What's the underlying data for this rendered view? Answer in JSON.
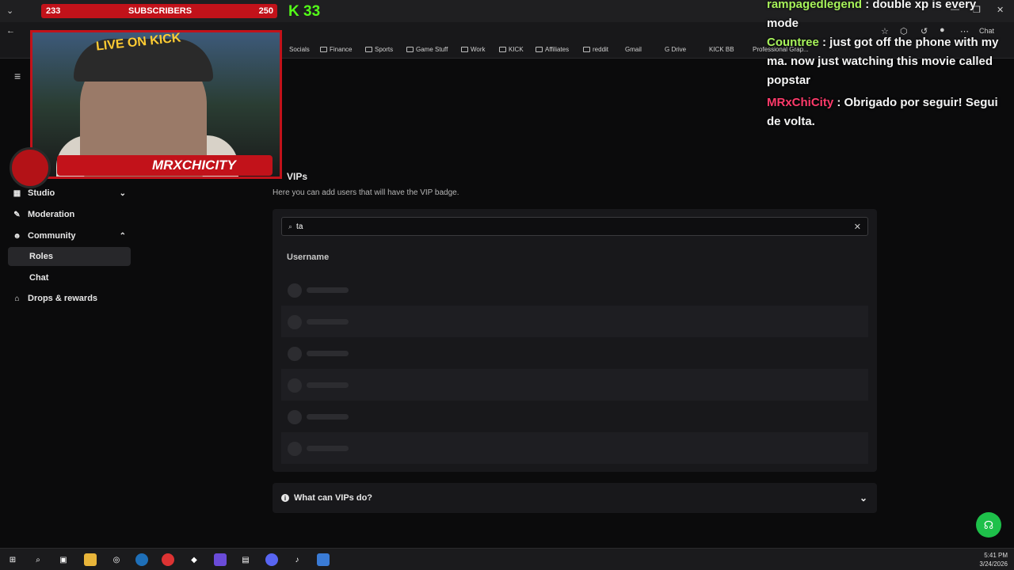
{
  "overlay": {
    "sub_current": "233",
    "sub_label": "SUBSCRIBERS",
    "sub_goal": "250",
    "kick_count": "33",
    "webcam_text": "LIVE ON KICK",
    "social_handle": "MRXCHICITY"
  },
  "chat": [
    {
      "user": "rampagedlegend",
      "text": " : double xp is every mode"
    },
    {
      "user": "Countree",
      "text": " : just got off the phone with my ma. now just watching this movie called popstar"
    },
    {
      "user": "MRxChiCity",
      "text": " : Obrigado por seguir! Segui de volta."
    }
  ],
  "bookmarks": [
    "Socials",
    "Finance",
    "Sports",
    "Game Stuff",
    "Work",
    "KICK",
    "Affiliates",
    "reddit",
    "Gmail",
    "G Drive",
    "KICK BB",
    "Professional Grap..."
  ],
  "browser": {
    "chat_label": "Chat"
  },
  "sidebar": {
    "studio": "Studio",
    "moderation": "Moderation",
    "community": "Community",
    "roles": "Roles",
    "chat": "Chat",
    "drops": "Drops & rewards"
  },
  "vips": {
    "title": "VIPs",
    "description": "Here you can add users that will have the VIP badge.",
    "search_value": "ta",
    "column_header": "Username",
    "faq_label": "What can VIPs do?"
  },
  "taskbar": {
    "time": "5:41 PM",
    "date": "3/24/2026"
  },
  "colors": {
    "kick_green": "#53fc18",
    "overlay_red": "#c2121a"
  }
}
